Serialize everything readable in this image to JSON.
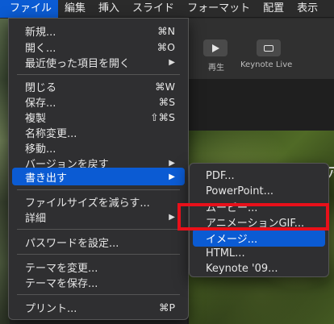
{
  "menubar": {
    "items": [
      "ファイル",
      "編集",
      "挿入",
      "スライド",
      "フォーマット",
      "配置",
      "表示"
    ]
  },
  "toolbar": {
    "play_label": "再生",
    "keynote_live_label": "Keynote Live"
  },
  "slide": {
    "title_fragment": "ア"
  },
  "file_menu": {
    "new": {
      "label": "新規...",
      "shortcut": "⌘N"
    },
    "open": {
      "label": "開く...",
      "shortcut": "⌘O"
    },
    "recent": {
      "label": "最近使った項目を開く"
    },
    "close": {
      "label": "閉じる",
      "shortcut": "⌘W"
    },
    "save": {
      "label": "保存...",
      "shortcut": "⌘S"
    },
    "duplicate": {
      "label": "複製",
      "shortcut": "⇧⌘S"
    },
    "rename": {
      "label": "名称変更..."
    },
    "move": {
      "label": "移動..."
    },
    "revert": {
      "label": "バージョンを戻す"
    },
    "export": {
      "label": "書き出す"
    },
    "reduce": {
      "label": "ファイルサイズを減らす..."
    },
    "advanced": {
      "label": "詳細"
    },
    "password": {
      "label": "パスワードを設定..."
    },
    "change_theme": {
      "label": "テーマを変更..."
    },
    "save_theme": {
      "label": "テーマを保存..."
    },
    "print": {
      "label": "プリント...",
      "shortcut": "⌘P"
    }
  },
  "export_menu": {
    "items": [
      "PDF...",
      "PowerPoint...",
      "ムービー...",
      "アニメーションGIF...",
      "イメージ...",
      "HTML...",
      "Keynote '09..."
    ]
  },
  "colors": {
    "highlight": "#0b5bd3",
    "annotation": "#e8101a"
  }
}
